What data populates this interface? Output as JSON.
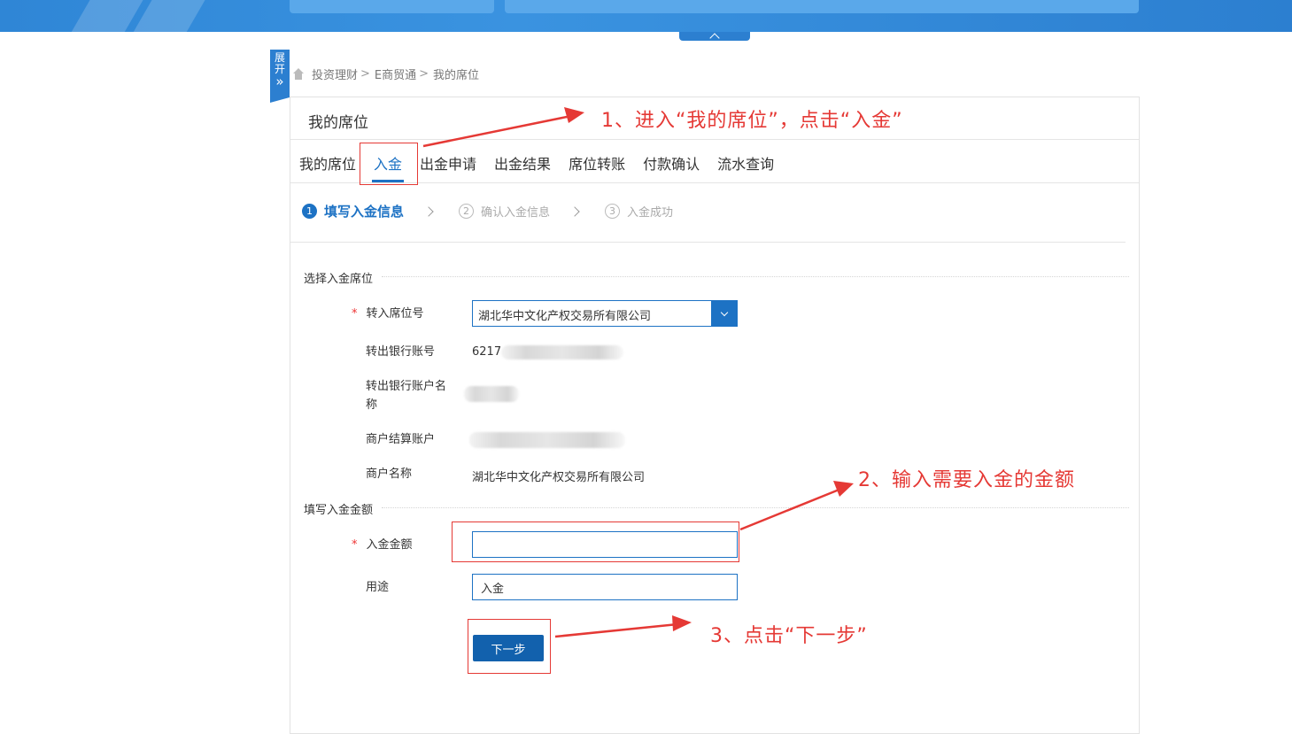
{
  "sidebar_toggle": {
    "label_line1": "展",
    "label_line2": "开",
    "label_line3": "»"
  },
  "breadcrumb": {
    "items": [
      "投资理财",
      "E商贸通",
      "我的席位"
    ],
    "separator": ">"
  },
  "panel": {
    "title": "我的席位"
  },
  "tabs": [
    {
      "label": "我的席位",
      "active": false
    },
    {
      "label": "入金",
      "active": true
    },
    {
      "label": "出金申请",
      "active": false
    },
    {
      "label": "出金结果",
      "active": false
    },
    {
      "label": "席位转账",
      "active": false
    },
    {
      "label": "付款确认",
      "active": false
    },
    {
      "label": "流水查询",
      "active": false
    }
  ],
  "steps": [
    {
      "num": "1",
      "label": "填写入金信息",
      "active": true
    },
    {
      "num": "2",
      "label": "确认入金信息",
      "active": false
    },
    {
      "num": "3",
      "label": "入金成功",
      "active": false
    }
  ],
  "section_seat": {
    "title": "选择入金席位",
    "seat_label": "转入席位号",
    "seat_value": "湖北华中文化产权交易所有限公司",
    "bank_account_label": "转出银行账号",
    "bank_account_value": "6217",
    "bank_name_label_1": "转出银行账户名",
    "bank_name_label_2": "称",
    "merchant_account_label": "商户结算账户",
    "merchant_name_label": "商户名称",
    "merchant_name_value": "湖北华中文化产权交易所有限公司"
  },
  "section_amount": {
    "title": "填写入金金额",
    "amount_label": "入金金额",
    "amount_value": "",
    "purpose_label": "用途",
    "purpose_value": "入金"
  },
  "required_mark": "*",
  "next_button": "下一步",
  "annotations": {
    "step1": "1、进入“我的席位”，点击“入金”",
    "step2": "2、输入需要入金的金额",
    "step3": "3、点击“下一步”"
  },
  "colors": {
    "accent": "#1d72c4",
    "annotation": "#e53935",
    "banner": "#2f86d6"
  }
}
